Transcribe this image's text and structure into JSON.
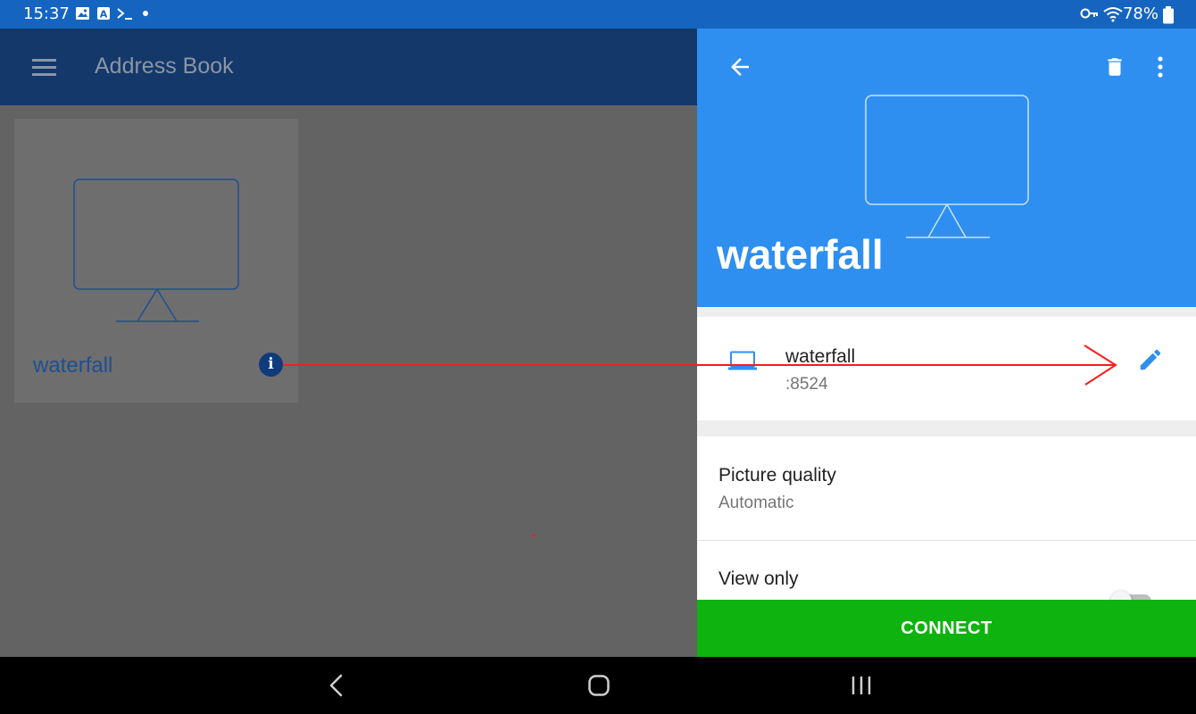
{
  "status_bar": {
    "time": "15:37",
    "icons": [
      "image-icon",
      "a-icon",
      "terminal-icon",
      "dot-icon",
      "key-icon",
      "wifi-icon",
      "battery-icon"
    ],
    "battery_text": "78%"
  },
  "address_book": {
    "title": "Address Book",
    "menu_icon": "hamburger-menu-icon",
    "card": {
      "name": "waterfall",
      "icon": "monitor-icon",
      "info_glyph": "i"
    }
  },
  "detail": {
    "title": "waterfall",
    "header_color": "#2e8ff0",
    "actions": [
      "back-arrow-icon",
      "delete-icon",
      "more-vert-icon"
    ],
    "host": {
      "name": "waterfall",
      "port": ":8524",
      "icon": "laptop-icon",
      "edit_icon": "pencil-icon"
    },
    "picture_quality": {
      "label": "Picture quality",
      "value": "Automatic"
    },
    "view_only": {
      "label": "View only",
      "enabled": false
    },
    "connect_label": "CONNECT",
    "connect_color": "#0fb30f"
  },
  "annotation": {
    "color": "#ff1a1a"
  },
  "nav_bar": {
    "icons": [
      "nav-back-icon",
      "nav-home-icon",
      "nav-recents-icon"
    ]
  }
}
